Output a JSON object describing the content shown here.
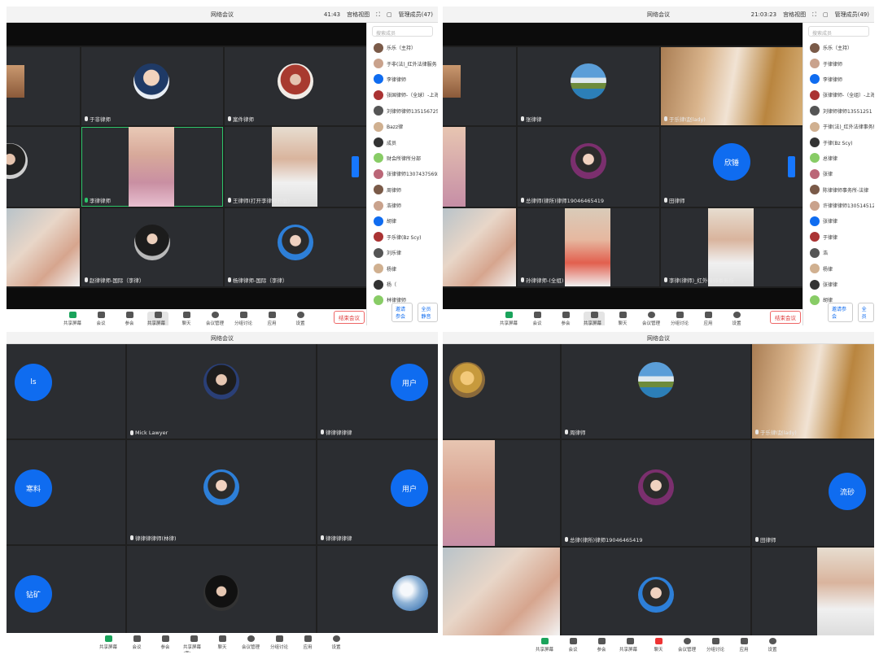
{
  "window_title": "网络会议",
  "panes": [
    {
      "meeting_id": "41:43",
      "view_mode": "宫格视图",
      "manager_label": "管理成员(47)",
      "names": [
        "于非律师",
        "案件律师",
        "李律律师",
        "王律师(打开李律师开庭)",
        "赵律律师-国际（李律）",
        "杨律律师-国际（李律）"
      ],
      "search_placeholder": "搜索成员",
      "participants": [
        "乐乐（主持）",
        "于非(法)_红外法律服务",
        "李律律师",
        "张国律师-（全球）-上海",
        "刘律师律师1351567254",
        "Bazz律",
        "成员",
        "财会所律所分部",
        "张律律师13074375693",
        "周律师",
        "浩律师",
        "胡律",
        "于乐律(Bz Scy)",
        "刘乐律",
        "杨律",
        "杨（",
        "林律律师"
      ],
      "invite_label": "邀请参会",
      "mute_all_label": "全员静音",
      "leave_label": "结束会议"
    },
    {
      "meeting_id": "21:03:23",
      "view_mode": "宫格视图",
      "manager_label": "管理成员(49)",
      "names": [
        "张律律",
        "于乐律(赵lady)",
        "总律师(律所)律师19046465419",
        "田律师",
        "孙律律师-(全组)",
        "李律(律师)_红外律师事务所"
      ],
      "blue_text": "欣锤",
      "search_placeholder": "搜索成员",
      "participants": [
        "乐乐（主持）",
        "于律律师",
        "李律律师",
        "张律律师-（全组）-上海",
        "刘律师律师13551251",
        "于律(法)_红外法律事务所",
        "于律(Bz Scy)",
        "总律律",
        "张律",
        "陈律律师事务所-法律",
        "许律律律师13051451234",
        "张律律",
        "于律律",
        "浩",
        "杨律",
        "张律律",
        "胡律"
      ],
      "invite_label": "邀请参会",
      "mute_all_label": "全员",
      "leave_label": "结束会议"
    },
    {
      "names": [
        "Mick Lawyer",
        "律律律律律",
        "律律律律师(林律)",
        "律律律律律"
      ],
      "blue_texts": [
        "ls",
        "用户",
        "寒料",
        "用户",
        "钻矿"
      ]
    },
    {
      "names": [
        "周律师",
        "于乐律(赵lady)",
        "总律(律所)律师19046465419",
        "田律师"
      ],
      "blue_text": "流砂"
    }
  ],
  "toolbar": [
    "共享屏幕",
    "会议",
    "参会",
    "共享屏幕(宽)",
    "聊天",
    "会议管理",
    "分组讨论",
    "应用",
    "设置"
  ],
  "colors": {
    "accent": "#0f6cf0",
    "leave": "#d33333"
  }
}
